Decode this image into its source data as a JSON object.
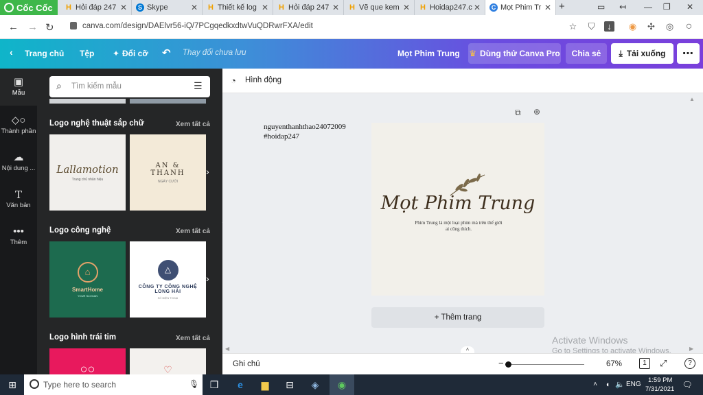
{
  "browser": {
    "brand": "Cốc Cốc",
    "tabs": [
      {
        "label": "Hỏi đáp 247",
        "icon": "hoidap-favicon"
      },
      {
        "label": "Skype",
        "icon": "skype-favicon"
      },
      {
        "label": "Thiết kế log",
        "icon": "hoidap-favicon"
      },
      {
        "label": "Hỏi đáp 247",
        "icon": "hoidap-favicon"
      },
      {
        "label": "Vẽ que kem",
        "icon": "hoidap-favicon"
      },
      {
        "label": "Hoidap247.c",
        "icon": "hoidap-favicon"
      },
      {
        "label": "Mọt Phim Tr",
        "icon": "canva-favicon"
      }
    ],
    "url": "canva.com/design/DAElvr56-iQ/7PCgqedkxdtwVuQDRwrFXA/edit"
  },
  "toolbar": {
    "home": "Trang chủ",
    "file": "Tệp",
    "resize": "Đổi cỡ",
    "unsaved": "Thay đổi chưa lưu",
    "title": "Mọt Phim Trung",
    "try_pro": "Dùng thử Canva Pro",
    "share": "Chia sẻ",
    "download": "Tải xuống"
  },
  "rail": {
    "items": [
      {
        "label": "Mẫu",
        "icon": "template-icon"
      },
      {
        "label": "Thành phần",
        "icon": "elements-icon"
      },
      {
        "label": "Nội dung ...",
        "icon": "upload-icon"
      },
      {
        "label": "Văn bản",
        "icon": "text-icon"
      },
      {
        "label": "Thêm",
        "icon": "more-icon"
      }
    ]
  },
  "panel": {
    "search_placeholder": "Tìm kiếm mẫu",
    "see_all": "Xem tất cả",
    "sections": [
      {
        "title": "Logo nghệ thuật sắp chữ",
        "thumbs": [
          {
            "text": "Lallamotion",
            "sub": "Trang chủ nhãn hiệu"
          },
          {
            "text": "AN & THANH",
            "sub": "NGÀY CƯỚI"
          }
        ]
      },
      {
        "title": "Logo công nghệ",
        "thumbs": [
          {
            "text": "SmartHome",
            "sub": "YOUR SLOGAN"
          },
          {
            "text": "CÔNG TY CÔNG NGHỆ LONG HẢI",
            "sub": "SỐ ĐIỆN THOẠI"
          }
        ]
      },
      {
        "title": "Logo hình trái tim",
        "thumbs": [
          {
            "text": ""
          },
          {
            "text": ""
          }
        ]
      }
    ]
  },
  "editor": {
    "animate": "Hình động",
    "note_text": "nguyenthanhthao24072009\n#hoidap247",
    "design_title": "Mọt Phim Trung",
    "design_sub": "Phim Trung là một loại phim mà trên thế giới ai cũng thích.",
    "add_page": "+ Thêm trang",
    "notes": "Ghi chú",
    "zoom": "67%",
    "page_num": "1",
    "watermark_title": "Activate Windows",
    "watermark_sub": "Go to Settings to activate Windows."
  },
  "taskbar": {
    "search_placeholder": "Type here to search",
    "lang": "ENG",
    "time": "1:59 PM",
    "date": "7/31/2021"
  }
}
